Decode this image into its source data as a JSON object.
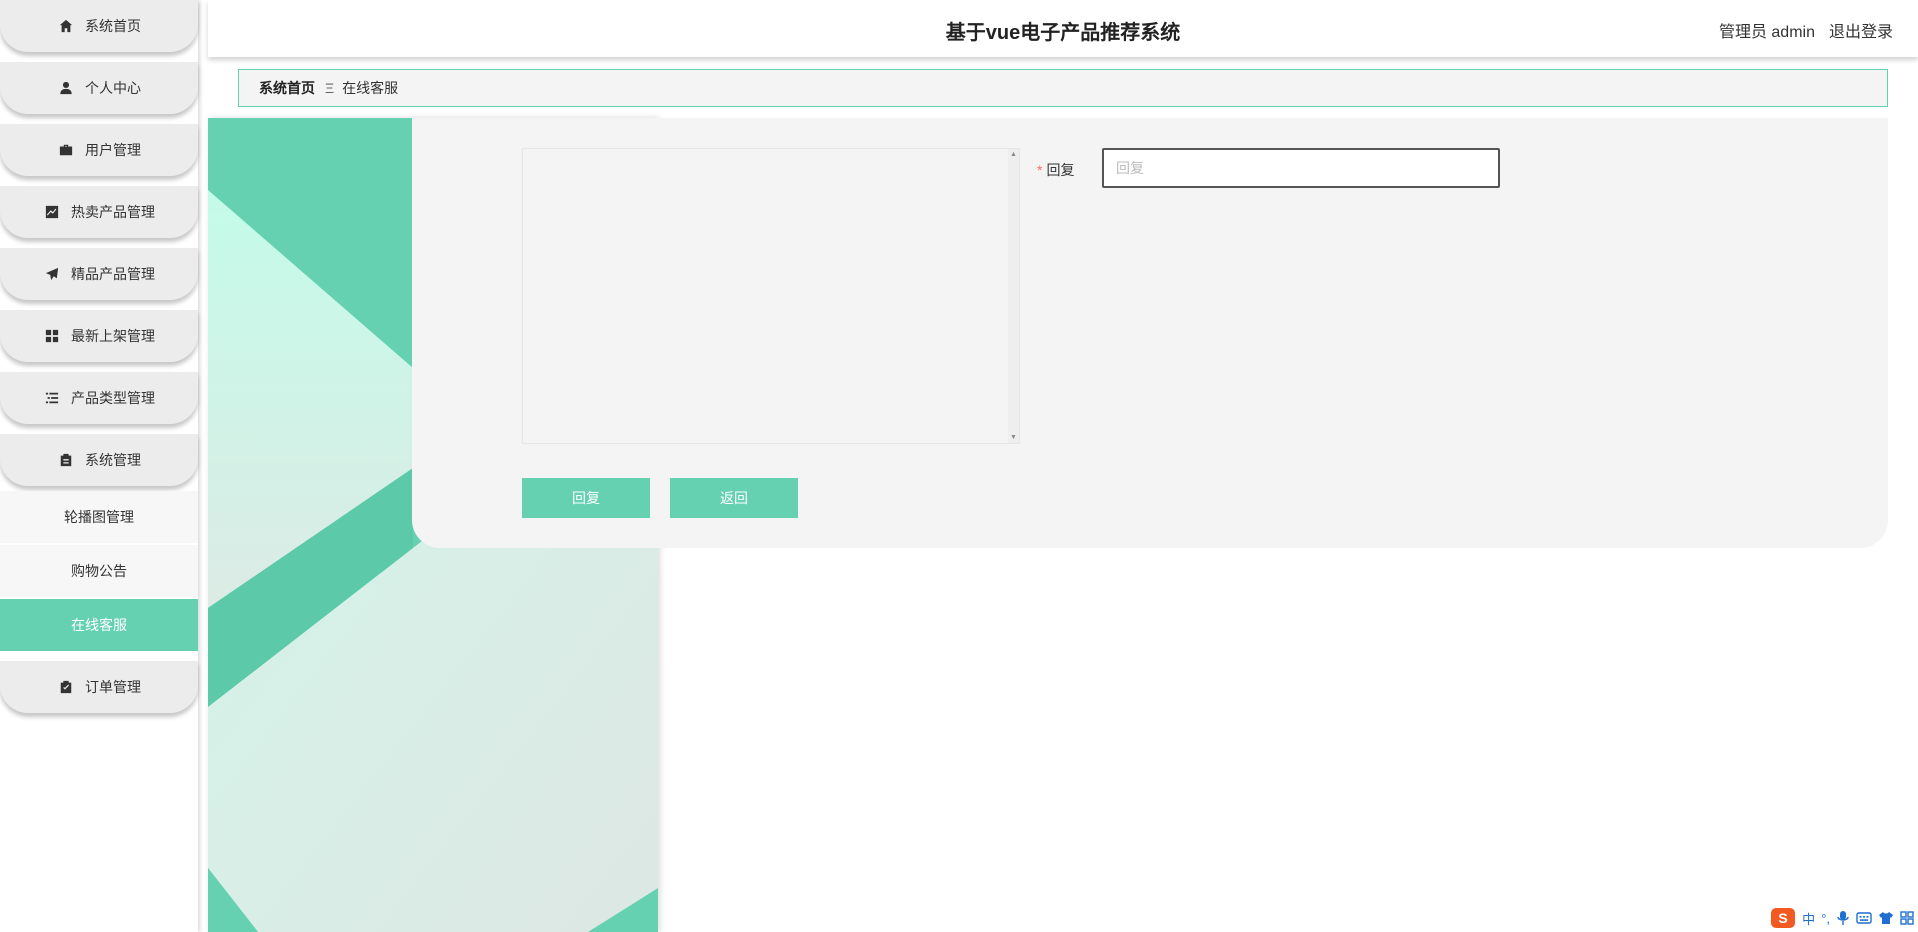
{
  "header": {
    "title": "基于vue电子产品推荐系统",
    "user_label": "管理员 admin",
    "logout_label": "退出登录"
  },
  "sidebar": {
    "items": [
      {
        "label": "系统首页",
        "icon": "home-icon"
      },
      {
        "label": "个人中心",
        "icon": "user-icon"
      },
      {
        "label": "用户管理",
        "icon": "briefcase-icon"
      },
      {
        "label": "热卖产品管理",
        "icon": "trend-chart-icon"
      },
      {
        "label": "精品产品管理",
        "icon": "paper-plane-icon"
      },
      {
        "label": "最新上架管理",
        "icon": "grid-icon"
      },
      {
        "label": "产品类型管理",
        "icon": "list-icon"
      },
      {
        "label": "系统管理",
        "icon": "clipboard-icon"
      }
    ],
    "sub_items": [
      {
        "label": "轮播图管理",
        "active": false
      },
      {
        "label": "购物公告",
        "active": false
      },
      {
        "label": "在线客服",
        "active": true
      }
    ],
    "order_item": {
      "label": "订单管理",
      "icon": "clipboard-check-icon"
    }
  },
  "breadcrumb": {
    "home": "系统首页",
    "separator": "Ξ",
    "current": "在线客服"
  },
  "form": {
    "chat_history": "",
    "reply_label": "回复",
    "reply_required_mark": "*",
    "reply_placeholder": "回复",
    "reply_value": "",
    "submit_label": "回复",
    "back_label": "返回"
  },
  "tray": {
    "ime_label": "中",
    "punct_label": "°,"
  },
  "colors": {
    "accent": "#66d1b0",
    "card_bg": "#f5f4f4",
    "required": "#f56c6c"
  }
}
